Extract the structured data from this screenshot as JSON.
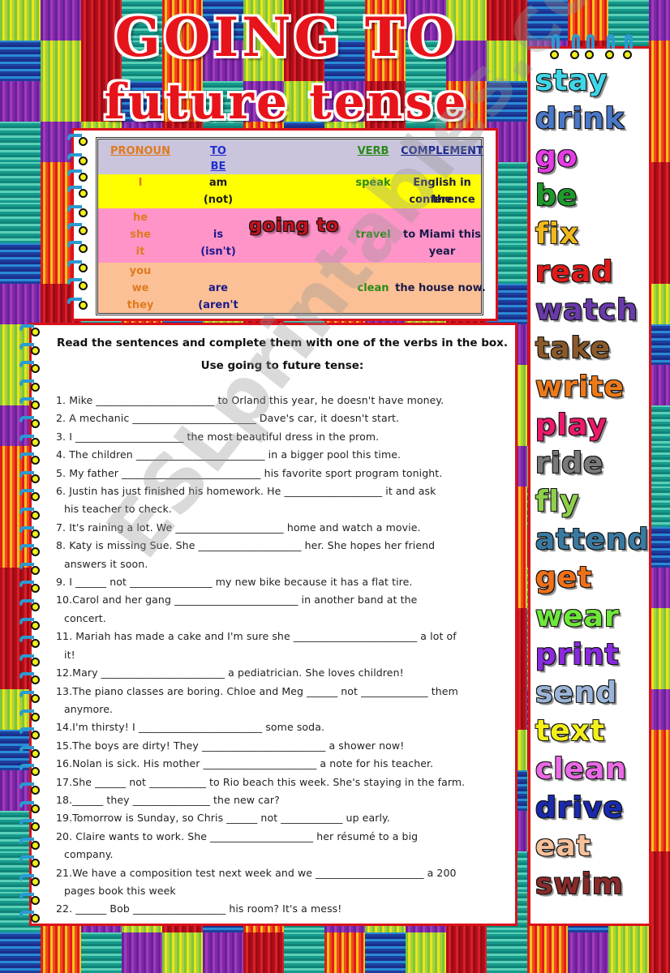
{
  "title": {
    "line1": "GOING TO",
    "line2": "future tense"
  },
  "grammar_table": {
    "headers": {
      "pronoun": "PRONOUN",
      "to_be_1": "TO",
      "to_be_2": "BE",
      "verb": "VERB",
      "complement": "COMPLEMENT"
    },
    "going_to_label": "going to",
    "rows": [
      {
        "pronouns": [
          "I"
        ],
        "to_be": [
          "am",
          "(not)"
        ],
        "verb": "speak",
        "complement": [
          "English in the",
          "conference"
        ]
      },
      {
        "pronouns": [
          "he",
          "she",
          "it"
        ],
        "to_be": [
          "is",
          "(isn't)"
        ],
        "verb": "travel",
        "complement": [
          "to Miami this",
          "year"
        ]
      },
      {
        "pronouns": [
          "you",
          "we",
          "they"
        ],
        "to_be": [
          "are",
          "(aren't"
        ],
        "verb": "clean",
        "complement": [
          "the house now."
        ]
      }
    ]
  },
  "exercise": {
    "instructions": "Read the sentences and complete them with one of the verbs in the box. Use going to future tense:",
    "sentences": [
      {
        "text": "1.    Mike _______________________ to Orland this year, he doesn't have money."
      },
      {
        "text": "2.  A mechanic ________________________ Dave's car, it doesn't start."
      },
      {
        "text": "3. I _____________________ the most beautiful dress in the prom."
      },
      {
        "text": "4.  The children _________________________ in a bigger pool this time."
      },
      {
        "text": "5.  My father ___________________________ his favorite sport program tonight."
      },
      {
        "text": "6.  Justin has just finished his homework. He ___________________ it and ask",
        "cont": "his teacher to check."
      },
      {
        "text": "7.  It's raining a lot. We _____________________ home and watch a movie."
      },
      {
        "text": "8.  Katy is missing Sue. She ____________________ her. She hopes her friend",
        "cont": "answers it soon."
      },
      {
        "text": "9.  I ______ not ________________ my new bike because it has a flat tire."
      },
      {
        "text": "10.Carol and her gang ________________________ in another band at the",
        "cont": "concert."
      },
      {
        "text": "11. Mariah has made a cake and I'm sure she ________________________ a lot of",
        "cont": "it!"
      },
      {
        "text": "12.Mary ________________________ a pediatrician. She loves children!"
      },
      {
        "text": "13.The piano classes are boring. Chloe and Meg ______ not  _____________ them",
        "cont": "anymore."
      },
      {
        "text": "14.I'm thirsty! I ________________________ some soda."
      },
      {
        "text": "15.The boys are dirty! They ________________________ a shower now!"
      },
      {
        "text": "16.Nolan is sick. His mother ______________________ a note for his teacher."
      },
      {
        "text": "17.She ______ not ___________ to Rio beach this week. She's staying in the farm."
      },
      {
        "text": "18.______ they _______________ the new car?"
      },
      {
        "text": "19.Tomorrow is Sunday, so Chris ______ not ____________ up early."
      },
      {
        "text": "20.  Claire wants to work. She ____________________ her résumé to a big",
        "cont": "company."
      },
      {
        "text": "21.We have a composition test next week and we _____________________ a 200",
        "cont": "pages book this week"
      },
      {
        "text": "22.  ______ Bob __________________ his room? It's a mess!"
      }
    ]
  },
  "verb_box": {
    "verbs": [
      {
        "word": "stay",
        "color": "#3fd6e8"
      },
      {
        "word": "drink",
        "color": "#4a78c8"
      },
      {
        "word": "go",
        "color": "#e63ce6"
      },
      {
        "word": "be",
        "color": "#1e9a2a"
      },
      {
        "word": "fix",
        "color": "#f0b81a"
      },
      {
        "word": "read",
        "color": "#e01a1a"
      },
      {
        "word": "watch",
        "color": "#6a3aaa"
      },
      {
        "word": "take",
        "color": "#8a5a2a"
      },
      {
        "word": "write",
        "color": "#ec7a1a"
      },
      {
        "word": "play",
        "color": "#ec1a6a"
      },
      {
        "word": "ride",
        "color": "#7a7a7a"
      },
      {
        "word": "fly",
        "color": "#8ed04a"
      },
      {
        "word": "attend",
        "color": "#3a7aa0"
      },
      {
        "word": "get",
        "color": "#f0701a"
      },
      {
        "word": "wear",
        "color": "#6ee83a"
      },
      {
        "word": "print",
        "color": "#8a2ae0"
      },
      {
        "word": "send",
        "color": "#9ab4d8"
      },
      {
        "word": "text",
        "color": "#f4f01a"
      },
      {
        "word": "clean",
        "color": "#ea6ae6"
      },
      {
        "word": "drive",
        "color": "#1a2ab0"
      },
      {
        "word": "eat",
        "color": "#f6c09a"
      },
      {
        "word": "swim",
        "color": "#8a2a2a"
      }
    ]
  },
  "watermark": "ESLprintables.com",
  "colors": {
    "frame_red": "#d9121b",
    "title_red": "#e8141b",
    "header_row": "#cac4dc",
    "row_I": "#ffff00",
    "row_he_she_it": "#ff94c8",
    "row_you_we_they": "#fbc095",
    "spiral_blue": "#2a9ad2",
    "ring_yellow": "#f2ee1a"
  }
}
